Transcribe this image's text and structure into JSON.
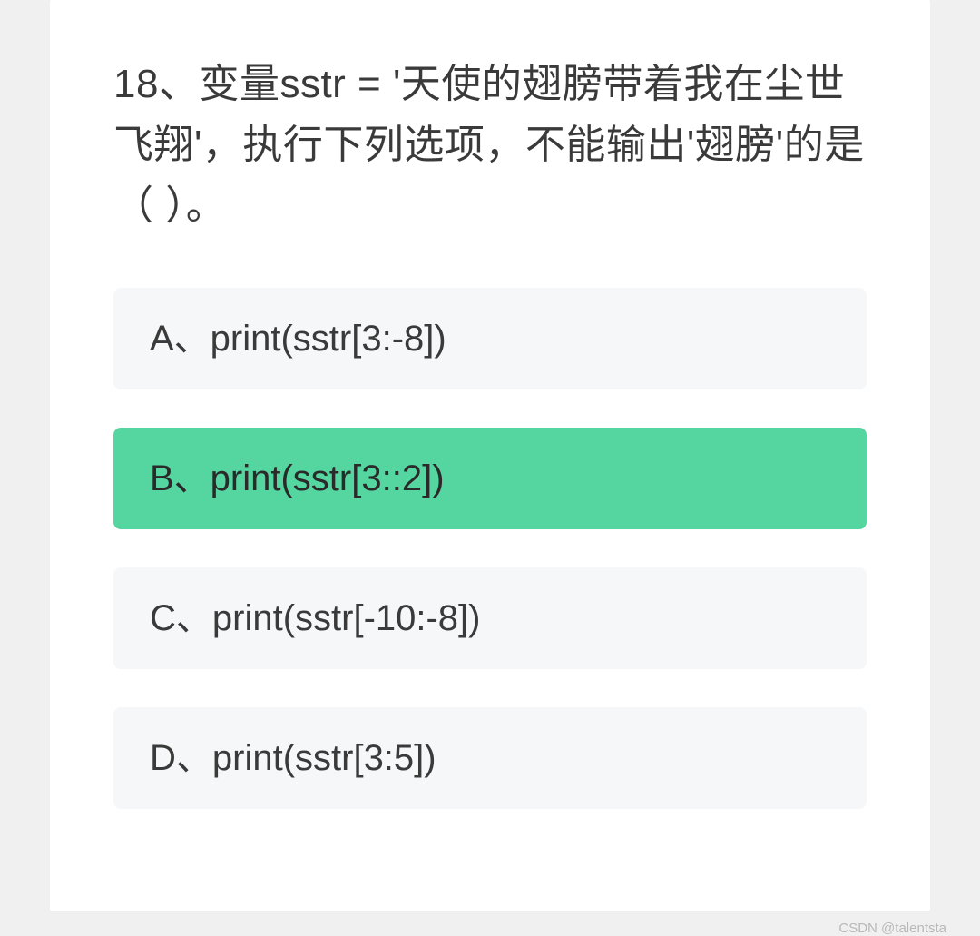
{
  "question": "18、变量sstr = '天使的翅膀带着我在尘世飞翔'，执行下列选项，不能输出'翅膀'的是（ ）。",
  "options": [
    {
      "label": "A、print(sstr[3:-8])",
      "selected": false
    },
    {
      "label": "B、print(sstr[3::2])",
      "selected": true
    },
    {
      "label": "C、print(sstr[-10:-8])",
      "selected": false
    },
    {
      "label": "D、print(sstr[3:5])",
      "selected": false
    }
  ],
  "watermark": "CSDN @talentsta"
}
